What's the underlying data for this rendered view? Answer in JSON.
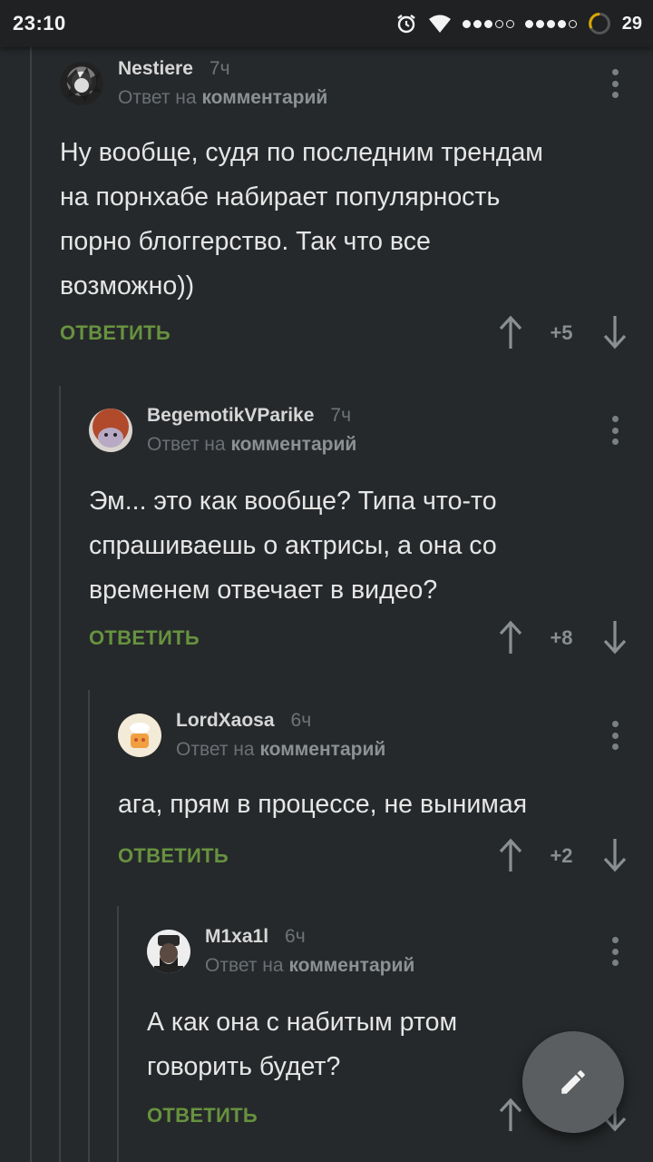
{
  "status_bar": {
    "time": "23:10",
    "battery": "29",
    "icons": [
      "alarm-icon",
      "wifi-icon",
      "signal-1-icon",
      "signal-2-icon",
      "battery-icon"
    ]
  },
  "colors": {
    "background": "#26292b",
    "reply_green": "#67923f",
    "fab": "#5b5e60"
  },
  "comments": [
    {
      "author": "Nestiere",
      "age": "7ч",
      "reply_prefix": "Ответ на",
      "reply_target": "комментарий",
      "lines": [
        "Ну вообще, судя по последним трендам",
        "на порнхабе набирает популярность",
        "порно блоггерство. Так что все",
        "возможно))"
      ],
      "reply_label": "ОТВЕТИТЬ",
      "score": "+5"
    },
    {
      "author": "BegemotikVParike",
      "age": "7ч",
      "reply_prefix": "Ответ на",
      "reply_target": "комментарий",
      "lines": [
        "Эм... это как вообще? Типа что-то",
        "спрашиваешь о актрисы, а она со",
        "временем отвечает в видео?"
      ],
      "reply_label": "ОТВЕТИТЬ",
      "score": "+8"
    },
    {
      "author": "LordXaosa",
      "age": "6ч",
      "reply_prefix": "Ответ на",
      "reply_target": "комментарий",
      "lines": [
        "ага, прям в процессе, не вынимая"
      ],
      "reply_label": "ОТВЕТИТЬ",
      "score": "+2"
    },
    {
      "author": "M1xa1l",
      "age": "6ч",
      "reply_prefix": "Ответ на",
      "reply_target": "комментарий",
      "lines": [
        "А как она с набитым ртом",
        "говорить будет?"
      ],
      "reply_label": "ОТВЕТИТЬ",
      "score": ""
    }
  ],
  "fab": {
    "icon": "pencil-icon"
  }
}
